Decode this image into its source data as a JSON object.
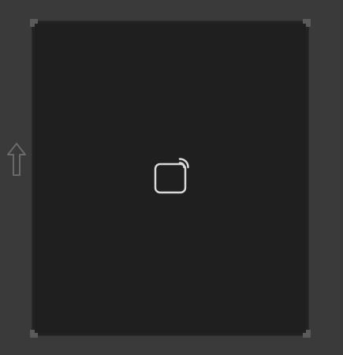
{
  "icons": {
    "arrow": "upload-arrow-icon",
    "center": "cast-icon"
  },
  "colors": {
    "background": "#3a3a3a",
    "frame": "#1f1f1f",
    "icon_stroke": "#d9d9d9",
    "arrow_stroke": "#6a6a6a"
  }
}
